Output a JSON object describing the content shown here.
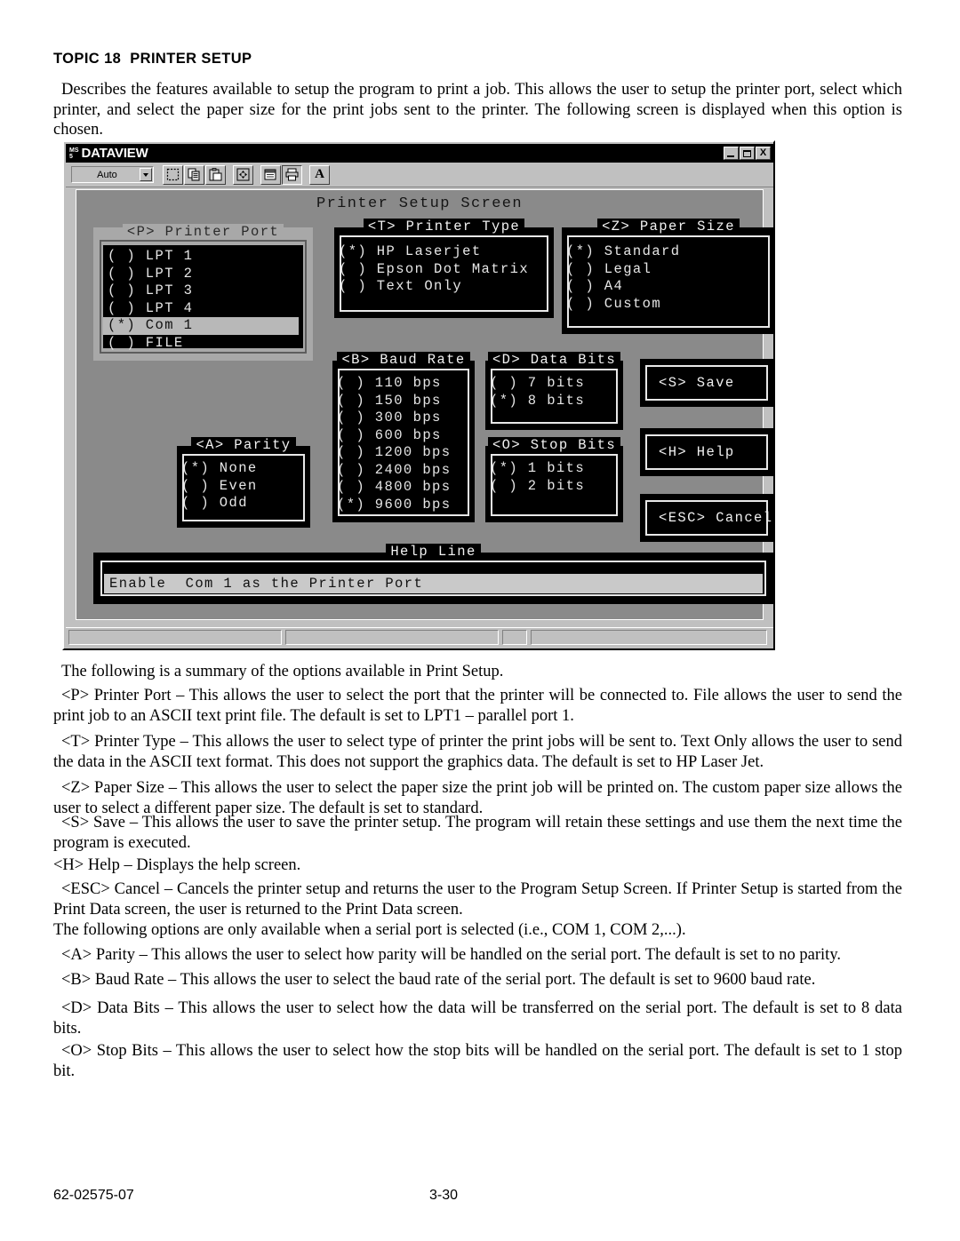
{
  "document": {
    "topic_heading": "TOPIC 18  PRINTER SETUP",
    "intro": "Describes the features available to setup the program to print a job. This allows the user to setup the printer port, select which printer, and select the paper size for the print jobs sent to the printer. The following screen is displayed when this option is chosen.",
    "paragraphs": [
      "The following is a summary of the options available in Print Setup.",
      "<P> Printer Port – This allows the user to select the port that the printer will be connected to. File allows the user to send the print job to an ASCII text print file. The default is set to LPT1 – parallel port 1.",
      "<T> Printer Type – This allows the user to select type of printer the print jobs will be sent to. Text Only allows the user to send the data in the ASCII text format. This does not support the graphics data. The default is set to HP Laser Jet.",
      "<Z> Paper Size – This allows the user to select the paper size the print job will be printed on. The custom paper size allows the user to select a different paper size. The default is set to standard.",
      "<S> Save – This allows the user to save the printer setup. The program will retain these settings and use them the next time the program is executed.",
      "<H> Help – Displays the help screen.",
      "<ESC> Cancel – Cancels the printer setup and returns the user to the Program Setup Screen. If Printer Setup is started from the Print Data screen, the user is returned to the Print Data screen.",
      "The following options are only available when a serial port is selected (i.e., COM 1, COM 2,...).",
      "<A> Parity – This allows the user to select how parity will be handled on the serial port. The default is set to no parity.",
      "<B> Baud Rate – This allows the user to select the baud rate of the serial port. The default is set to 9600 baud rate.",
      "<D> Data Bits – This allows the user to select how the data will be transferred on the serial port. The default is set to 8 data bits.",
      "<O> Stop Bits – This allows the user to select how the stop bits will be handled on the serial port. The default is set to 1 stop bit."
    ],
    "footer": {
      "doc_number": "62-02575-07",
      "page_number": "3-30"
    }
  },
  "app": {
    "titlebar": {
      "logo_top": "MS",
      "logo_bottom": "5",
      "title": "DATAVIEW",
      "minimize_label": "_",
      "restore_label": "❐",
      "close_label": "X"
    },
    "toolbar": {
      "zoom_combo_value": "Auto",
      "zoom_combo_placeholder": "Auto",
      "buttons": [
        {
          "name": "select-marquee-icon",
          "label": ""
        },
        {
          "name": "copy-icon",
          "label": ""
        },
        {
          "name": "paste-icon",
          "label": ""
        },
        {
          "name": "fit-to-window-icon",
          "label": ""
        },
        {
          "name": "properties-icon",
          "label": ""
        },
        {
          "name": "print-icon",
          "label": ""
        },
        {
          "name": "text-tool-icon",
          "label": "A"
        }
      ]
    },
    "screen": {
      "title": "Printer Setup Screen",
      "printer_port": {
        "legend": "<P> Printer Port",
        "options": [
          {
            "marker": "( )",
            "label": "LPT 1",
            "selected": false
          },
          {
            "marker": "( )",
            "label": "LPT 2",
            "selected": false
          },
          {
            "marker": "( )",
            "label": "LPT 3",
            "selected": false
          },
          {
            "marker": "( )",
            "label": "LPT 4",
            "selected": false
          },
          {
            "marker": "(*)",
            "label": "Com 1",
            "selected": true
          },
          {
            "marker": "( )",
            "label": "FILE",
            "selected": false
          }
        ]
      },
      "printer_type": {
        "legend": "<T> Printer Type",
        "options": [
          {
            "marker": "(*)",
            "label": "HP Laserjet",
            "selected": true
          },
          {
            "marker": "( )",
            "label": "Epson Dot Matrix",
            "selected": false
          },
          {
            "marker": "( )",
            "label": "Text Only",
            "selected": false
          }
        ]
      },
      "paper_size": {
        "legend": "<Z> Paper Size",
        "options": [
          {
            "marker": "(*)",
            "label": "Standard",
            "selected": true
          },
          {
            "marker": "( )",
            "label": "Legal",
            "selected": false
          },
          {
            "marker": "( )",
            "label": "A4",
            "selected": false
          },
          {
            "marker": "( )",
            "label": "Custom",
            "selected": false
          }
        ]
      },
      "baud_rate": {
        "legend": "<B> Baud Rate",
        "options": [
          {
            "marker": "( )",
            "label": "110 bps",
            "selected": false
          },
          {
            "marker": "( )",
            "label": "150 bps",
            "selected": false
          },
          {
            "marker": "( )",
            "label": "300 bps",
            "selected": false
          },
          {
            "marker": "( )",
            "label": "600 bps",
            "selected": false
          },
          {
            "marker": "( )",
            "label": "1200 bps",
            "selected": false
          },
          {
            "marker": "( )",
            "label": "2400 bps",
            "selected": false
          },
          {
            "marker": "( )",
            "label": "4800 bps",
            "selected": false
          },
          {
            "marker": "(*)",
            "label": "9600 bps",
            "selected": true
          }
        ]
      },
      "data_bits": {
        "legend": "<D> Data Bits",
        "options": [
          {
            "marker": "( )",
            "label": "7 bits",
            "selected": false
          },
          {
            "marker": "(*)",
            "label": "8 bits",
            "selected": true
          }
        ]
      },
      "stop_bits": {
        "legend": "<O> Stop Bits",
        "options": [
          {
            "marker": "(*)",
            "label": "1 bits",
            "selected": true
          },
          {
            "marker": "( )",
            "label": "2 bits",
            "selected": false
          }
        ]
      },
      "parity": {
        "legend": "<A> Parity",
        "options": [
          {
            "marker": "(*)",
            "label": "None",
            "selected": true
          },
          {
            "marker": "( )",
            "label": "Even",
            "selected": false
          },
          {
            "marker": "( )",
            "label": "Odd",
            "selected": false
          }
        ]
      },
      "buttons": {
        "save": "<S> Save",
        "help": "<H> Help",
        "cancel": "<ESC> Cancel"
      },
      "help_line": {
        "legend": "Help Line",
        "text": "Enable  Com 1 as the Printer Port"
      }
    },
    "statusbar": {
      "panes": [
        "",
        "",
        "",
        ""
      ]
    }
  },
  "colors": {
    "window_face": "#c0c0c0",
    "dos_background": "#8a8a8a",
    "dos_group_bg": "#000000",
    "dos_text": "#e6e6e6",
    "dos_highlight": "#b8b8b8",
    "titlebar": "#000000"
  }
}
